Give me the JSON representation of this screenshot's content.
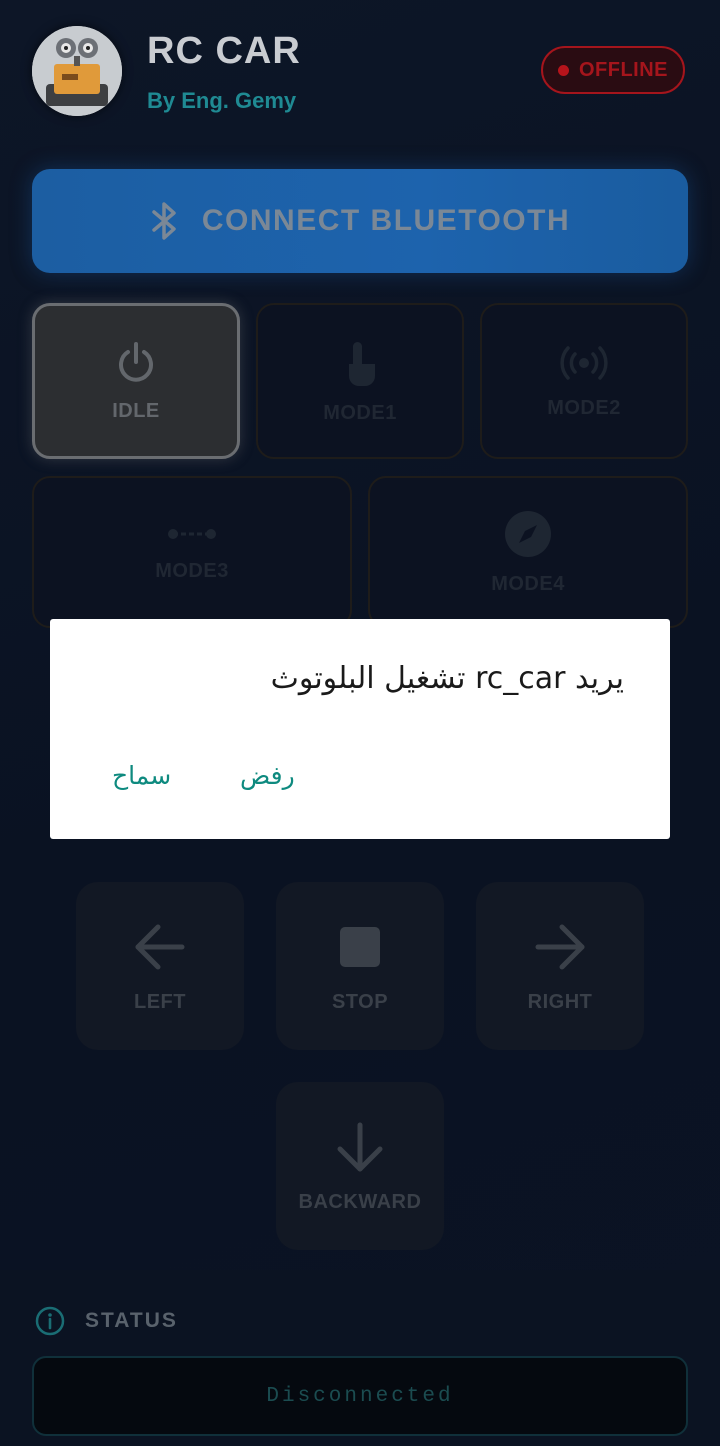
{
  "header": {
    "title": "RC CAR",
    "subtitle": "By Eng. Gemy",
    "status_badge": "OFFLINE",
    "avatar_icon": "robot-avatar-icon"
  },
  "connect_button": {
    "label": "CONNECT BLUETOOTH",
    "icon": "bluetooth-icon"
  },
  "modes": [
    {
      "label": "IDLE",
      "icon": "power-icon",
      "active": true
    },
    {
      "label": "MODE1",
      "icon": "touch-icon",
      "active": false
    },
    {
      "label": "MODE2",
      "icon": "broadcast-icon",
      "active": false
    },
    {
      "label": "MODE3",
      "icon": "line-follow-icon",
      "active": false
    },
    {
      "label": "MODE4",
      "icon": "compass-icon",
      "active": false
    }
  ],
  "controls": {
    "left": "LEFT",
    "stop": "STOP",
    "right": "RIGHT",
    "backward": "BACKWARD"
  },
  "status": {
    "heading": "STATUS",
    "message": "Disconnected"
  },
  "dialog": {
    "message": "يريد rc_car تشغيل البلوتوث",
    "allow": "سماح",
    "deny": "رفض"
  },
  "colors": {
    "accent_teal": "#1f8a93",
    "offline_red": "#a5151c",
    "connect_blue": "#1d63ad",
    "dialog_button": "#0e8a7f"
  }
}
